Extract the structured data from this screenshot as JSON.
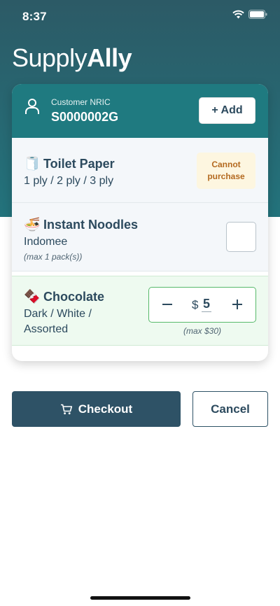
{
  "status_bar": {
    "time": "8:37"
  },
  "logo": {
    "light": "Supply",
    "bold": "Ally"
  },
  "customer": {
    "label": "Customer NRIC",
    "nric": "S0000002G",
    "add_label": "+ Add"
  },
  "items": [
    {
      "emoji": "🧻",
      "name": "Toilet Paper",
      "description": "1 ply / 2 ply / 3 ply",
      "status_line1": "Cannot",
      "status_line2": "purchase"
    },
    {
      "emoji": "🍜",
      "name": "Instant Noodles",
      "description": "Indomee",
      "limit": "(max 1 pack(s))",
      "checked": false
    },
    {
      "emoji": "🍫",
      "name": "Chocolate",
      "description_line1": "Dark / White /",
      "description_line2": "Assorted",
      "currency": "$",
      "amount": "5",
      "limit": "(max $30)"
    }
  ],
  "actions": {
    "checkout_label": "Checkout",
    "cancel_label": "Cancel"
  },
  "colors": {
    "header": "#23737c",
    "card_head": "#1f7a80",
    "primary_button": "#2e5266",
    "cannot_bg": "#fdf6e0",
    "cannot_text": "#b46a20",
    "selected_bg": "#eefaf0",
    "selected_border": "#57b96a"
  },
  "icons": [
    "wifi-icon",
    "battery-icon",
    "user-icon",
    "minus-icon",
    "plus-icon",
    "cart-icon"
  ]
}
